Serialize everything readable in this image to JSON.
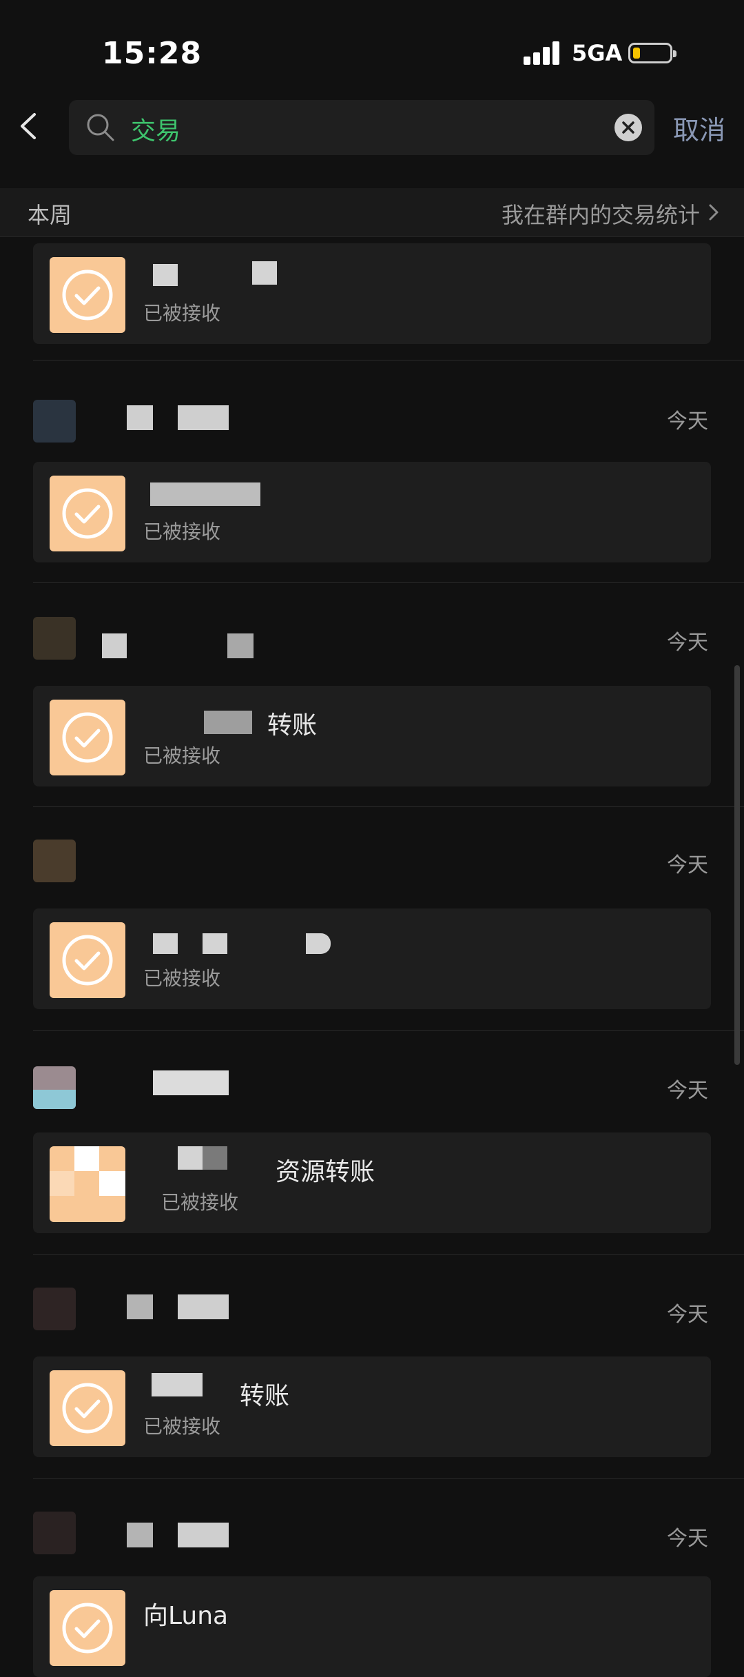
{
  "status_bar": {
    "time": "15:28",
    "network": "5GA"
  },
  "search": {
    "query": "交易",
    "cancel_label": "取消"
  },
  "section": {
    "title": "本周",
    "stats_link": "我在群内的交易统计"
  },
  "items": [
    {
      "date": "",
      "title": "",
      "status": "已被接收"
    },
    {
      "date": "今天",
      "title": "",
      "status": "已被接收"
    },
    {
      "date": "今天",
      "title": "转账",
      "status": "已被接收"
    },
    {
      "date": "今天",
      "title": "",
      "status": "已被接收"
    },
    {
      "date": "今天",
      "title": "资源转账",
      "status": "已被接收"
    },
    {
      "date": "今天",
      "title": "转账",
      "status": "已被接收"
    },
    {
      "date": "今天",
      "title": "向Luna",
      "status": ""
    }
  ],
  "colors": {
    "accent": "#3ec46d",
    "transfer_icon": "#f9c896",
    "cancel": "#8a98b5"
  }
}
